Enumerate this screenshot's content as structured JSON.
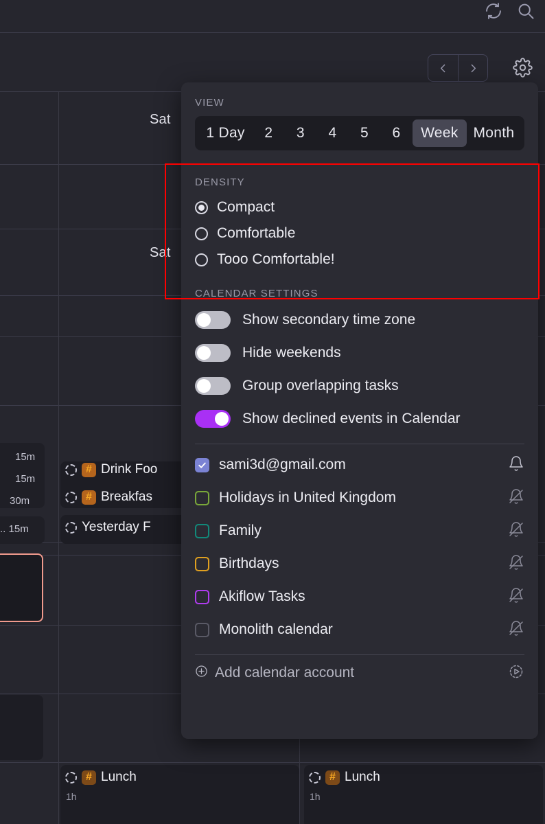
{
  "app": {
    "background_color": "#26262e",
    "panel_color": "#2b2b33",
    "accent_color": "#a930f5",
    "annotation_color": "#ff0000"
  },
  "toolbar": {
    "sync_icon": "sync-icon",
    "search_icon": "search-icon",
    "prev_icon": "chevron-left-icon",
    "next_icon": "chevron-right-icon",
    "settings_icon": "gear-icon"
  },
  "calendar_background": {
    "day_labels": [
      "Sat",
      "Sat"
    ],
    "task_chips": [
      {
        "duration": "15m"
      },
      {
        "duration": "15m"
      },
      {
        "duration": "30m"
      },
      {
        "prefix": "..",
        "duration": "15m"
      }
    ],
    "events": [
      {
        "title": "Drink Foo",
        "badge": "#",
        "icon": "task-circle-icon"
      },
      {
        "title": "Breakfas",
        "badge": "#",
        "icon": "task-circle-icon"
      },
      {
        "title": "Yesterday F",
        "badge": "",
        "icon": "task-circle-icon"
      },
      {
        "title": "Lunch",
        "badge": "#",
        "duration": "1h",
        "icon": "task-circle-icon"
      },
      {
        "title": "Lunch",
        "badge": "#",
        "duration": "1h",
        "icon": "task-circle-icon"
      }
    ]
  },
  "panel": {
    "view": {
      "label": "VIEW",
      "options": [
        "1 Day",
        "2",
        "3",
        "4",
        "5",
        "6",
        "Week",
        "Month"
      ],
      "selected": "Week"
    },
    "density": {
      "label": "DENSITY",
      "options": [
        "Compact",
        "Comfortable",
        "Tooo Comfortable!"
      ],
      "selected": "Compact"
    },
    "calendar_settings": {
      "label": "CALENDAR SETTINGS",
      "toggles": [
        {
          "label": "Show secondary time zone",
          "on": false
        },
        {
          "label": "Hide weekends",
          "on": false
        },
        {
          "label": "Group overlapping tasks",
          "on": false
        },
        {
          "label": "Show declined events in Calendar",
          "on": true
        }
      ]
    },
    "calendars": [
      {
        "label": "sami3d@gmail.com",
        "checked": true,
        "color": "#7b83d4",
        "bell": "bell-icon",
        "muted": false
      },
      {
        "label": "Holidays in United Kingdom",
        "checked": false,
        "color": "#7aa83a",
        "bell": "bell-off-icon",
        "muted": true
      },
      {
        "label": "Family",
        "checked": false,
        "color": "#12897a",
        "bell": "bell-off-icon",
        "muted": true
      },
      {
        "label": "Birthdays",
        "checked": false,
        "color": "#e0a020",
        "bell": "bell-off-icon",
        "muted": true
      },
      {
        "label": "Akiflow Tasks",
        "checked": false,
        "color": "#b03cf0",
        "bell": "bell-off-icon",
        "muted": true
      },
      {
        "label": "Monolith calendar",
        "checked": false,
        "color": "#5a5a66",
        "bell": "bell-off-icon",
        "muted": true
      }
    ],
    "footer": {
      "add_label": "Add calendar account",
      "add_icon": "plus-circle-icon",
      "action_icon": "clock-play-icon"
    }
  }
}
